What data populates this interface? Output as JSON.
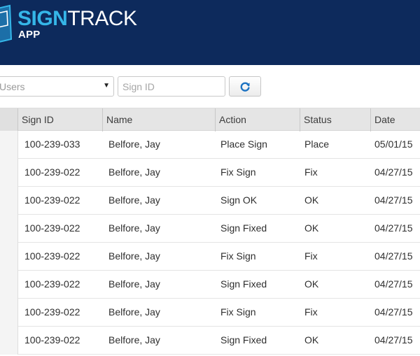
{
  "header": {
    "brand_sign": "SIGN",
    "brand_track": "TRACK",
    "brand_sub": "APP",
    "background": "#0d2a5c",
    "accent": "#35b6e8"
  },
  "toolbar": {
    "users_select_value": "Users",
    "sign_id_placeholder": "Sign ID",
    "refresh_icon": "refresh-icon"
  },
  "table": {
    "columns": [
      "Sign ID",
      "Name",
      "Action",
      "Status",
      "Date"
    ],
    "rows": [
      [
        "100-239-033",
        "Belfore, Jay",
        "Place Sign",
        "Place",
        "05/01/15"
      ],
      [
        "100-239-022",
        "Belfore, Jay",
        "Fix Sign",
        "Fix",
        "04/27/15"
      ],
      [
        "100-239-022",
        "Belfore, Jay",
        "Sign OK",
        "OK",
        "04/27/15"
      ],
      [
        "100-239-022",
        "Belfore, Jay",
        "Sign Fixed",
        "OK",
        "04/27/15"
      ],
      [
        "100-239-022",
        "Belfore, Jay",
        "Fix Sign",
        "Fix",
        "04/27/15"
      ],
      [
        "100-239-022",
        "Belfore, Jay",
        "Sign Fixed",
        "OK",
        "04/27/15"
      ],
      [
        "100-239-022",
        "Belfore, Jay",
        "Fix Sign",
        "Fix",
        "04/27/15"
      ],
      [
        "100-239-022",
        "Belfore, Jay",
        "Sign Fixed",
        "OK",
        "04/27/15"
      ]
    ]
  }
}
